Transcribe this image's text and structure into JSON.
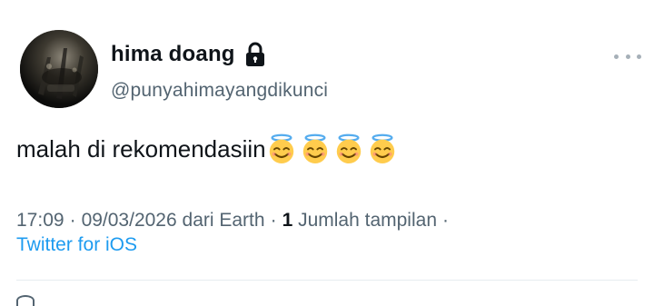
{
  "tweet": {
    "author": {
      "display_name": "hima doang",
      "handle": "@punyahimayangdikunci",
      "locked_icon": "lock-icon",
      "avatar_icon": "avatar-image"
    },
    "more_icon": "more-horizontal-icon",
    "text": "malah di rekomendasiin",
    "emojis": [
      "smiling-face-with-halo",
      "smiling-face-with-halo",
      "smiling-face-with-halo",
      "smiling-face-with-halo"
    ],
    "meta": {
      "time": "17:09",
      "separator": "·",
      "date": "09/03/2026",
      "location": "dari Earth",
      "views_count": "1",
      "views_label": "Jumlah tampilan",
      "source": "Twitter for iOS"
    }
  },
  "colors": {
    "text_primary": "#0f1419",
    "text_secondary": "#536471",
    "link": "#1d9bf0",
    "divider": "#e6ecf0"
  }
}
